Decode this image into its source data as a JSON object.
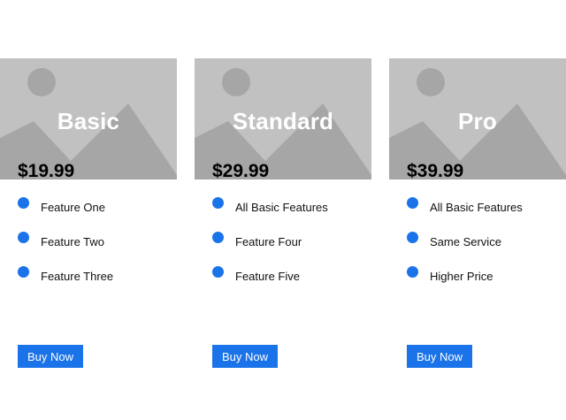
{
  "colors": {
    "accent": "#1a73e8",
    "hero_bg": "#c1c1c1",
    "hero_shape": "#a6a6a6"
  },
  "plans": [
    {
      "name": "Basic",
      "price": "$19.99",
      "image_icon": "image-placeholder-icon",
      "features": [
        "Feature One",
        "Feature Two",
        "Feature Three"
      ],
      "button_label": "Buy Now"
    },
    {
      "name": "Standard",
      "price": "$29.99",
      "image_icon": "image-placeholder-icon",
      "features": [
        "All Basic Features",
        "Feature Four",
        "Feature Five"
      ],
      "button_label": "Buy Now"
    },
    {
      "name": "Pro",
      "price": "$39.99",
      "image_icon": "image-placeholder-icon",
      "features": [
        "All Basic Features",
        "Same Service",
        "Higher Price"
      ],
      "button_label": "Buy Now"
    }
  ]
}
